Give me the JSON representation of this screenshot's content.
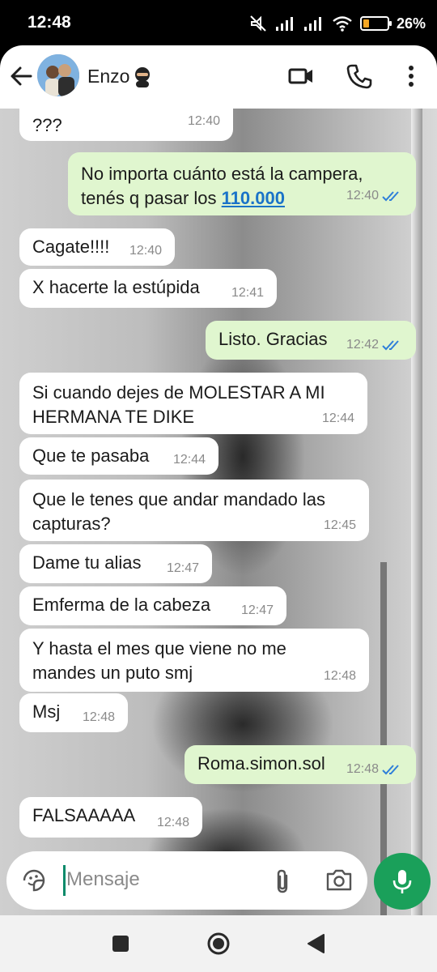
{
  "status": {
    "time": "12:48",
    "battery_pct": "26%",
    "battery_level": 0.26
  },
  "header": {
    "contact_name": "Enzo",
    "contact_emoji": "ninja-emoji",
    "icons": [
      "back-arrow-icon",
      "video-call-icon",
      "phone-icon",
      "more-vert-icon"
    ]
  },
  "messages": [
    {
      "dir": "in",
      "text": "???",
      "time": "12:40"
    },
    {
      "dir": "out",
      "text_a": "No importa cuánto está la campera,\ntenés q pasar los ",
      "link": "110.000",
      "time": "12:40",
      "read": true
    },
    {
      "dir": "in",
      "text": "Cagate!!!!",
      "time": "12:40"
    },
    {
      "dir": "in",
      "text": "X hacerte la estúpida",
      "time": "12:41"
    },
    {
      "dir": "out",
      "text": "Listo. Gracias",
      "time": "12:42",
      "read": true
    },
    {
      "dir": "in",
      "text": "Si cuando dejes de MOLESTAR A MI\nHERMANA TE DIKE",
      "time": "12:44"
    },
    {
      "dir": "in",
      "text": "Que te pasaba",
      "time": "12:44"
    },
    {
      "dir": "in",
      "text": "Que le tenes que andar mandado las\ncapturas?",
      "time": "12:45"
    },
    {
      "dir": "in",
      "text": "Dame tu alias",
      "time": "12:47"
    },
    {
      "dir": "in",
      "text": "Emferma de la cabeza",
      "time": "12:47"
    },
    {
      "dir": "in",
      "text": "Y hasta el mes que viene no me\nmandes un puto smj",
      "time": "12:48"
    },
    {
      "dir": "in",
      "text": "Msj",
      "time": "12:48"
    },
    {
      "dir": "out",
      "text": "Roma.simon.sol",
      "time": "12:48",
      "read": true
    },
    {
      "dir": "in",
      "text": "FALSAAAAA",
      "time": "12:48"
    }
  ],
  "input": {
    "placeholder": "Mensaje",
    "icons": [
      "sticker-icon",
      "attach-icon",
      "camera-icon",
      "mic-icon"
    ]
  },
  "nav": {
    "icons": [
      "recents-square-icon",
      "home-circle-icon",
      "back-triangle-icon"
    ]
  },
  "colors": {
    "incoming_bubble": "#ffffff",
    "outgoing_bubble": "#e0f6cf",
    "mic_button": "#1aa05a",
    "read_ticks": "#2f7fd9",
    "link": "#1a73c8"
  }
}
